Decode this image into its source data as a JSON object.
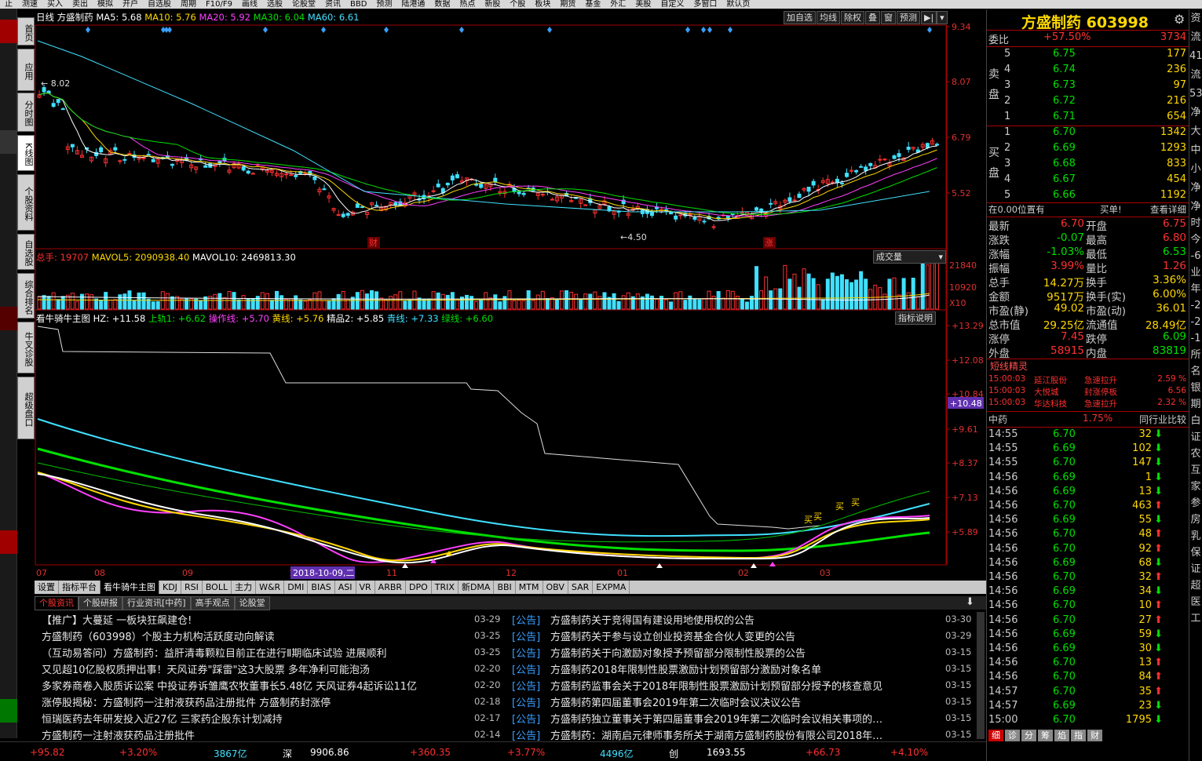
{
  "topbar": [
    "止",
    "测速",
    "买入",
    "卖出",
    "模拟",
    "开户",
    "自选股",
    "周期",
    "F10/F9",
    "画线",
    "选股",
    "论股堂",
    "资讯",
    "BBD",
    "预测",
    "陆港通",
    "数据",
    "热点",
    "新股",
    "个股",
    "板块",
    "期货",
    "基金",
    "外汇",
    "美股",
    "自定义",
    "多窗口",
    "默认页"
  ],
  "sidetabs": [
    "首页",
    "应用",
    "分时图",
    "K线图",
    "个股资料",
    "自选股",
    "综合排名",
    "牛叉诊股",
    "超级盘口"
  ],
  "kline": {
    "header": {
      "period": "日线",
      "name": "方盛制药",
      "ma5": "MA5: 5.68",
      "ma10": "MA10: 5.76",
      "ma20": "MA20: 5.92",
      "ma30": "MA30: 6.04",
      "ma60": "MA60: 6.61"
    },
    "buttons": [
      "加自选",
      "均线",
      "除权",
      "叠",
      "窗",
      "预测"
    ],
    "axis": [
      "9.34",
      "8.07",
      "6.79",
      "5.52"
    ],
    "high_label": "8.02",
    "low_label": "4.50",
    "marks": [
      "财",
      "涨"
    ]
  },
  "volume": {
    "header": {
      "total": "总手: 19707",
      "mavol5": "MAVOL5: 2090938.40",
      "mavol10": "MAVOL10: 2469813.30"
    },
    "dropdown": "成交量",
    "axis": [
      "21840",
      "10920",
      "X10"
    ]
  },
  "indicator": {
    "header": {
      "name": "看牛骑牛主图",
      "hz": "HZ: +11.58",
      "s1": "上轨1: +6.62",
      "s2": "操作线: +5.70",
      "s3": "黄线: +5.76",
      "s4": "精品2: +5.85",
      "s5": "青线: +7.33",
      "s6": "绿线: +6.60"
    },
    "button": "指标说明",
    "axis": [
      "13.29",
      "12.08",
      "10.84",
      "9.61",
      "8.37",
      "7.13",
      "5.89"
    ],
    "current": "10.48",
    "buy_marks": [
      "买",
      "买",
      "买",
      "买"
    ]
  },
  "xaxis": {
    "labels": [
      "07",
      "08",
      "09",
      "10",
      "11",
      "12",
      "01",
      "02",
      "03"
    ],
    "cursor": "2018-10-09,二"
  },
  "tabs": [
    "设置",
    "指标平台",
    "看牛骑牛主图",
    "KDJ",
    "RSI",
    "BOLL",
    "主力",
    "W&R",
    "DMI",
    "BIAS",
    "ASI",
    "VR",
    "ARBR",
    "DPO",
    "TRIX",
    "新DMA",
    "BBI",
    "MTM",
    "OBV",
    "SAR",
    "EXPMA"
  ],
  "newstabs": [
    "个股资讯",
    "个股研报",
    "行业资讯[中药]",
    "高手观点",
    "论股堂"
  ],
  "news_left": [
    {
      "title": "【推广】大蔓延 一板块狂飙建仓!",
      "date": "03-29"
    },
    {
      "title": "方盛制药（603998）个股主力机构活跃度动向解读",
      "date": "03-25"
    },
    {
      "title": "（互动易答问）方盛制药：益肝清毒颗粒目前正在进行Ⅱ期临床试验 进展顺利",
      "date": "03-25"
    },
    {
      "title": "又见超10亿股权质押出事！天风证券\"踩雷\"这3大股票 多年净利可能泡汤",
      "date": "02-20"
    },
    {
      "title": "多家券商卷入股质诉讼案 中投证券诉雏鹰农牧董事长5.48亿 天风证券4起诉讼11亿",
      "date": "02-20"
    },
    {
      "title": "涨停股揭秘：方盛制药一注射液获药品注册批件 方盛制药封涨停",
      "date": "02-18"
    },
    {
      "title": "恒瑞医药去年研发投入近27亿 三家药企股东计划减持",
      "date": "02-17"
    },
    {
      "title": "方盛制药一注射液获药品注册批件",
      "date": "02-14"
    }
  ],
  "news_right": [
    {
      "tag": "[公告]",
      "title": "方盛制药关于竞得国有建设用地使用权的公告",
      "date": "03-30"
    },
    {
      "tag": "[公告]",
      "title": "方盛制药关于参与设立创业投资基金合伙人变更的公告",
      "date": "03-29"
    },
    {
      "tag": "[公告]",
      "title": "方盛制药关于向激励对象授予预留部分限制性股票的公告",
      "date": "03-15"
    },
    {
      "tag": "[公告]",
      "title": "方盛制药2018年限制性股票激励计划预留部分激励对象名单",
      "date": "03-15"
    },
    {
      "tag": "[公告]",
      "title": "方盛制药监事会关于2018年限制性股票激励计划预留部分授予的核查意见",
      "date": "03-15"
    },
    {
      "tag": "[公告]",
      "title": "方盛制药第四届董事会2019年第二次临时会议决议公告",
      "date": "03-15"
    },
    {
      "tag": "[公告]",
      "title": "方盛制药独立董事关于第四届董事会2019年第二次临时会议相关事项的…",
      "date": "03-15"
    },
    {
      "tag": "[公告]",
      "title": "方盛制药：湖南启元律师事务所关于湖南方盛制药股份有限公司2018年…",
      "date": "03-15"
    }
  ],
  "bottom": {
    "a": "+95.82",
    "b": "+3.20%",
    "c": "3867亿",
    "d": "深",
    "e": "9906.86",
    "f": "+360.35",
    "g": "+3.77%",
    "h": "4496亿",
    "i": "创",
    "j": "1693.55",
    "k": "+66.73",
    "l": "+4.10%"
  },
  "quote": {
    "title": "方盛制药 603998",
    "weibi": {
      "label": "委比",
      "pct": "+57.50%",
      "val": "3734"
    },
    "sell_label": "卖盘",
    "buy_label": "买盘",
    "sells": [
      {
        "n": "5",
        "p": "6.75",
        "v": "177"
      },
      {
        "n": "4",
        "p": "6.74",
        "v": "236"
      },
      {
        "n": "3",
        "p": "6.73",
        "v": "97"
      },
      {
        "n": "2",
        "p": "6.72",
        "v": "216"
      },
      {
        "n": "1",
        "p": "6.71",
        "v": "654"
      }
    ],
    "buys": [
      {
        "n": "1",
        "p": "6.70",
        "v": "1342"
      },
      {
        "n": "2",
        "p": "6.69",
        "v": "1293"
      },
      {
        "n": "3",
        "p": "6.68",
        "v": "833"
      },
      {
        "n": "4",
        "p": "6.67",
        "v": "454"
      },
      {
        "n": "5",
        "p": "6.66",
        "v": "1192"
      }
    ],
    "position": "在0.00位置有",
    "buy_sig": "买单!",
    "detail": "查看详细",
    "stats": [
      [
        "最新",
        "6.70",
        "开盘",
        "6.75"
      ],
      [
        "涨跌",
        "-0.07",
        "最高",
        "6.80"
      ],
      [
        "涨幅",
        "-1.03%",
        "最低",
        "6.53"
      ],
      [
        "振幅",
        "3.99%",
        "量比",
        "1.26"
      ],
      [
        "总手",
        "14.27万",
        "换手",
        "3.36%"
      ],
      [
        "金额",
        "9517万",
        "换手(实)",
        "6.00%"
      ],
      [
        "市盈(静)",
        "49.02",
        "市盈(动)",
        "36.01"
      ],
      [
        "总市值",
        "29.25亿",
        "流通值",
        "28.49亿"
      ],
      [
        "涨停",
        "7.45",
        "跌停",
        "6.09"
      ],
      [
        "外盘",
        "58915",
        "内盘",
        "83819"
      ]
    ],
    "short_title": "短线精灵",
    "short": [
      {
        "t": "15:00:03",
        "n": "延江股份",
        "s": "急速拉升",
        "v": "2.59 %"
      },
      {
        "t": "15:00:03",
        "n": "大悦城",
        "s": "封涨停板",
        "v": "6.56"
      },
      {
        "t": "15:00:03",
        "n": "华达科技",
        "s": "急速拉升",
        "v": "2.32 %"
      }
    ],
    "industry": "中药",
    "industry_pct": "1.75%",
    "compare": "同行业比较",
    "ticks": [
      [
        "14:55",
        "6.70",
        "32",
        "dn"
      ],
      [
        "14:55",
        "6.69",
        "102",
        "dn"
      ],
      [
        "14:55",
        "6.70",
        "147",
        "dn"
      ],
      [
        "14:56",
        "6.69",
        "1",
        "dn"
      ],
      [
        "14:56",
        "6.69",
        "13",
        "dn"
      ],
      [
        "14:56",
        "6.70",
        "463",
        "up"
      ],
      [
        "14:56",
        "6.69",
        "55",
        "dn"
      ],
      [
        "14:56",
        "6.70",
        "48",
        "up"
      ],
      [
        "14:56",
        "6.70",
        "92",
        "up"
      ],
      [
        "14:56",
        "6.69",
        "68",
        "dn"
      ],
      [
        "14:56",
        "6.70",
        "32",
        "up"
      ],
      [
        "14:56",
        "6.69",
        "34",
        "dn"
      ],
      [
        "14:56",
        "6.70",
        "10",
        "up"
      ],
      [
        "14:56",
        "6.70",
        "27",
        "up"
      ],
      [
        "14:56",
        "6.69",
        "59",
        "dn"
      ],
      [
        "14:56",
        "6.69",
        "30",
        "dn"
      ],
      [
        "14:56",
        "6.70",
        "13",
        "up"
      ],
      [
        "14:56",
        "6.70",
        "84",
        "up"
      ],
      [
        "14:57",
        "6.70",
        "35",
        "up"
      ],
      [
        "14:57",
        "6.69",
        "23",
        "dn"
      ],
      [
        "15:00",
        "6.70",
        "1795",
        "dn"
      ]
    ],
    "bottom_tabs": [
      "细",
      "诊",
      "分",
      "筹",
      "焰",
      "指",
      "财"
    ]
  },
  "farright": [
    "资",
    "流",
    "41",
    "流",
    "53",
    "净",
    "大",
    "中",
    "小",
    "净",
    "净",
    "时",
    "今",
    "-6",
    "业",
    "年",
    "-2",
    "-2",
    "-1",
    "所",
    "名",
    "银",
    "期",
    "白",
    "证",
    "农",
    "互",
    "家",
    "参",
    "房",
    "乳",
    "保",
    "证",
    "超",
    "医",
    "工"
  ]
}
